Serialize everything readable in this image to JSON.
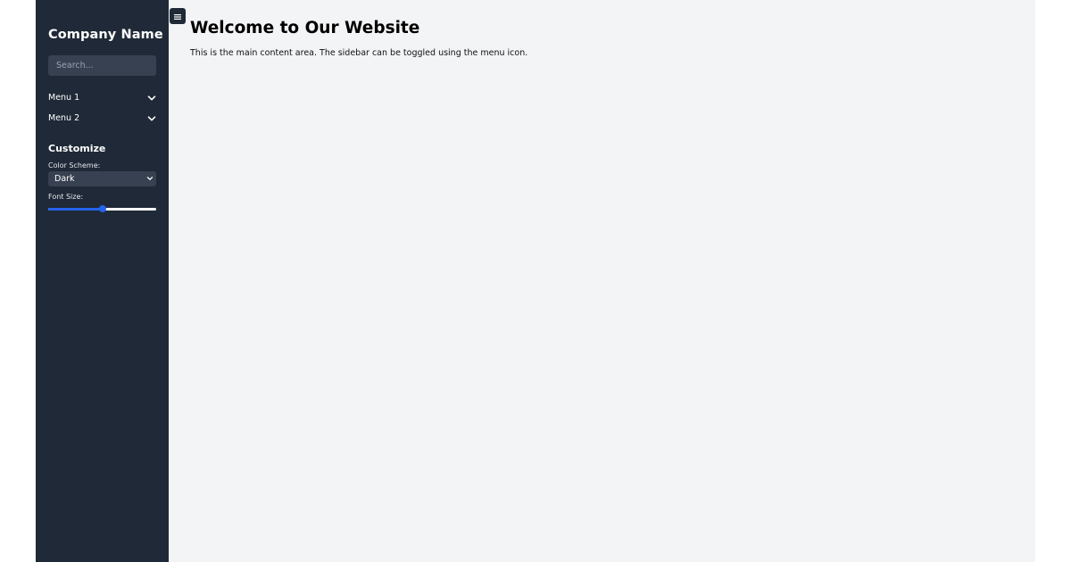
{
  "sidebar": {
    "brand": "Company Name",
    "search": {
      "placeholder": "Search...",
      "icon": "search-icon"
    },
    "menu": [
      {
        "label": "Menu 1",
        "icon": "chevron-down-icon"
      },
      {
        "label": "Menu 2",
        "icon": "chevron-down-icon"
      }
    ],
    "customize": {
      "title": "Customize",
      "color_scheme": {
        "label": "Color Scheme:",
        "value": "Dark"
      },
      "font_size": {
        "label": "Font Size:",
        "value_fraction": 0.5
      }
    }
  },
  "main": {
    "toggle_icon": "menu-icon",
    "title": "Welcome to Our Website",
    "description": "This is the main content area. The sidebar can be toggled using the menu icon."
  },
  "colors": {
    "sidebar_bg": "#1f2937",
    "main_bg": "#f3f4f6",
    "input_bg": "#374151",
    "accent": "#2563eb"
  }
}
